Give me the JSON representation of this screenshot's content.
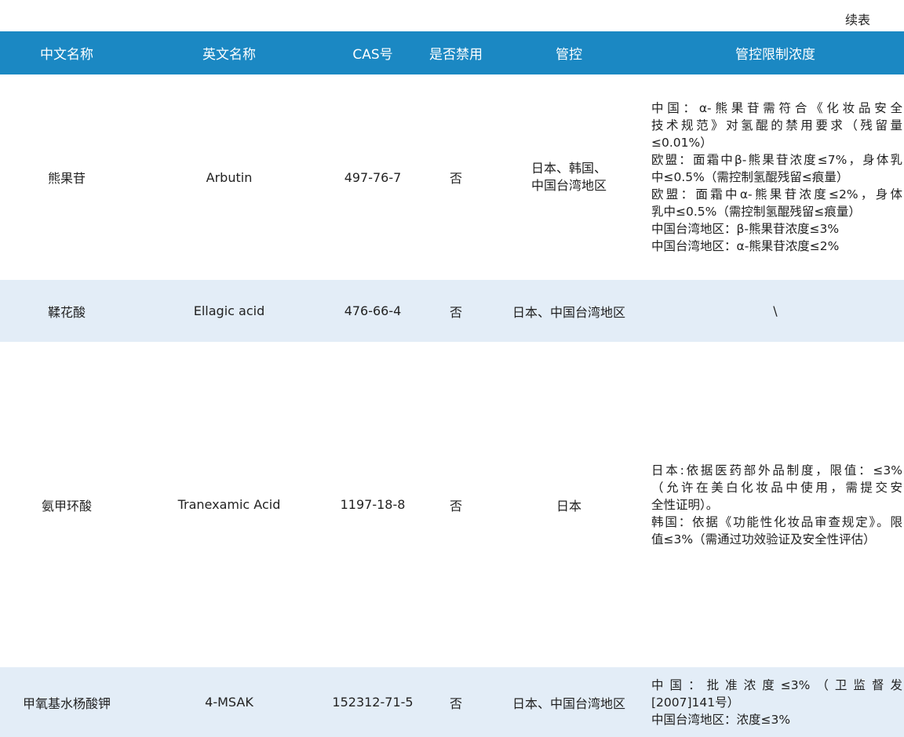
{
  "caption": "续表",
  "headers": [
    "中文名称",
    "英文名称",
    "CAS号",
    "是否禁用",
    "管控",
    "管控限制浓度"
  ],
  "rows": [
    {
      "cn": "熊果苷",
      "en": "Arbutin",
      "cas": "497-76-7",
      "banned": "否",
      "control": [
        "日本、韩国、",
        "中国台湾地区"
      ],
      "limit": [
        "中国：α-熊果苷需符合《化妆品安全",
        "技术规范》对氢醌的禁用要求（残留量",
        "≤0.01%）",
        "欧盟：面霜中β-熊果苷浓度≤7%，身体乳",
        "中≤0.5%（需控制氢醌残留≤痕量）",
        "欧盟：面霜中α-熊果苷浓度≤2%，身体",
        "乳中≤0.5%（需控制氢醌残留≤痕量）",
        "中国台湾地区：β-熊果苷浓度≤3%",
        "中国台湾地区：α-熊果苷浓度≤2%"
      ]
    },
    {
      "cn": "鞣花酸",
      "en": "Ellagic acid",
      "cas": "476-66-4",
      "banned": "否",
      "control": [
        "日本、中国台湾地区"
      ],
      "limit": [
        "\\"
      ]
    },
    {
      "cn": "氨甲环酸",
      "en": "Tranexamic Acid",
      "cas": "1197-18-8",
      "banned": "否",
      "control": [
        "日本"
      ],
      "limit": [
        "日本:依据医药部外品制度，限值：≤3%",
        "（允许在美白化妆品中使用，需提交安",
        "全性证明）。",
        "韩国：依据《功能性化妆品审查规定》。限",
        "值≤3%（需通过功效验证及安全性评估）"
      ]
    },
    {
      "cn": "甲氧基水杨酸钾",
      "en": "4-MSAK",
      "cas": "152312-71-5",
      "banned": "否",
      "control": [
        "日本、中国台湾地区"
      ],
      "limit": [
        "中国：批准浓度≤3%（卫监督发",
        "[2007]141号）",
        "中国台湾地区：浓度≤3%"
      ]
    }
  ]
}
